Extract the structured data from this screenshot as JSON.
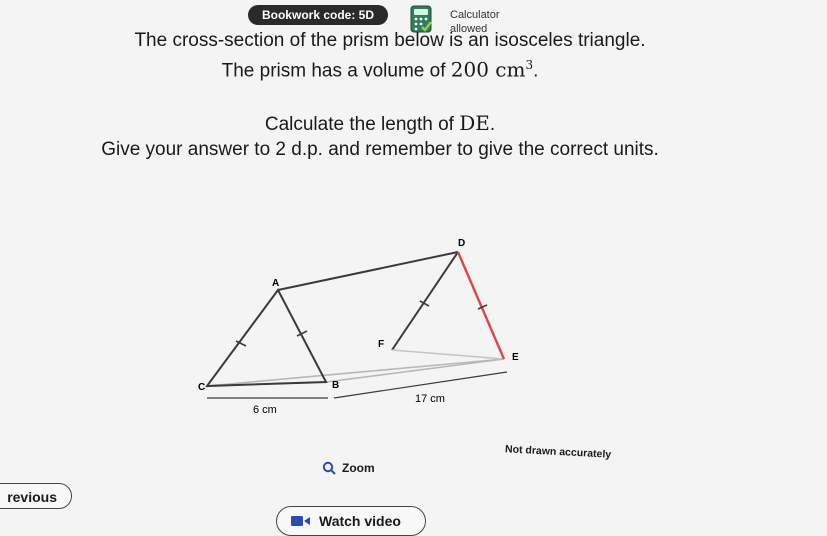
{
  "header": {
    "bookwork_label": "Bookwork code: 5D",
    "calculator_line1": "Calculator",
    "calculator_line2": "allowed"
  },
  "question": {
    "line1": "The cross-section of the prism below is an isosceles triangle.",
    "line2_text": "The prism has a volume of ",
    "line2_math": "200 cm",
    "line2_sup": "3",
    "line2_end": ".",
    "line3_text": "Calculate the length of ",
    "line3_math": "DE",
    "line3_end": ".",
    "line4": "Give your answer to 2 d.p. and remember to give the correct units."
  },
  "diagram": {
    "labels": {
      "A": "A",
      "B": "B",
      "C": "C",
      "D": "D",
      "E": "E",
      "F": "F"
    },
    "base_length": "6 cm",
    "prism_length": "17 cm",
    "highlight_color": "#e24444"
  },
  "not_drawn_label": "Not drawn accurately",
  "zoom_label": "Zoom",
  "previous_label": "revious",
  "watch_video_label": "Watch video"
}
